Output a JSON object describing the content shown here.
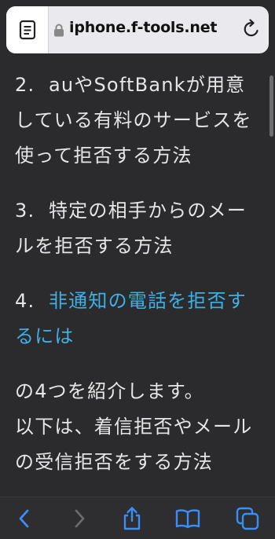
{
  "address_bar": {
    "url": "iphone.f-tools.net",
    "reader_icon": "reader-mode-icon",
    "lock_icon": "lock-icon",
    "reload_icon": "reload-icon"
  },
  "content": {
    "item2_num": "2.",
    "item2_text": "auやSoftBankが用意している有料のサービスを使って拒否する方法",
    "item3_num": "3.",
    "item3_text": "特定の相手からのメールを拒否する方法",
    "item4_num": "4.",
    "item4_link": "非通知の電話を拒否するには",
    "closing_1": "の4つを紹介します。",
    "closing_2": "以下は、着信拒否やメールの受信拒否をする方法"
  },
  "toolbar": {
    "back_icon": "back-icon",
    "forward_icon": "forward-icon",
    "share_icon": "share-icon",
    "bookmarks_icon": "bookmarks-icon",
    "tabs_icon": "tabs-icon"
  },
  "colors": {
    "background": "#2b2b2d",
    "text": "#e6e6e6",
    "link": "#3fb0e6",
    "toolbar_icon": "#3a8ef6"
  }
}
